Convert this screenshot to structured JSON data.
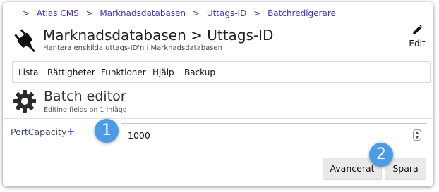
{
  "breadcrumb": {
    "items": [
      "Atlas CMS",
      "Marknadsdatabasen",
      "Uttags-ID",
      "Batchredigerare"
    ],
    "separator": ">"
  },
  "header": {
    "icon": "plug-icon",
    "title": "Marknadsdatabasen > Uttags-ID",
    "subtitle": "Hantera enskilda uttags-ID'n i Marknadsdatabasen",
    "edit_label": "Edit"
  },
  "nav": {
    "items": [
      "Lista",
      "Rättigheter",
      "Funktioner",
      "Hjälp",
      "Backup"
    ]
  },
  "section": {
    "icon": "gear-icon",
    "title": "Batch editor",
    "subtitle": "Editing fields on 1 Inlägg"
  },
  "form": {
    "field_label": "PortCapacity",
    "add_symbol": "+",
    "field_value": "1000"
  },
  "actions": {
    "advanced_label": "Avancerat",
    "save_label": "Spara"
  },
  "badges": [
    "1",
    "2"
  ],
  "colors": {
    "link": "#4a2fb4",
    "badge": "#4c9be6",
    "plus": "#3a3acb"
  }
}
